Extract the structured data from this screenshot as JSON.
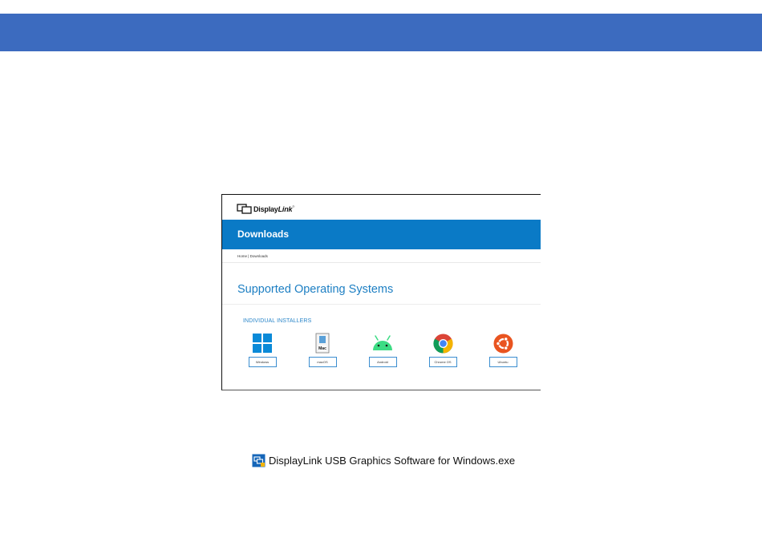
{
  "site": {
    "logo_display": "Display",
    "logo_link": "Link",
    "logo_tm": "®",
    "bar_title": "Downloads",
    "breadcrumb": "Home | Downloads",
    "heading": "Supported Operating Systems",
    "subheading": "INDIVIDUAL INSTALLERS",
    "mac_icon_label": "Mac",
    "os_buttons": [
      "Windows",
      "macOS",
      "Android",
      "Chrome OS",
      "Ubuntu"
    ]
  },
  "file": {
    "name": "DisplayLink USB Graphics Software for Windows.exe",
    "icon": "installer-icon"
  },
  "colors": {
    "banner": "#3c6bbf",
    "site_bar": "#0a7ac6",
    "heading": "#1d7fc3",
    "windows": "#0a8ad8",
    "android": "#3ddc84",
    "ubuntu": "#e95420"
  }
}
